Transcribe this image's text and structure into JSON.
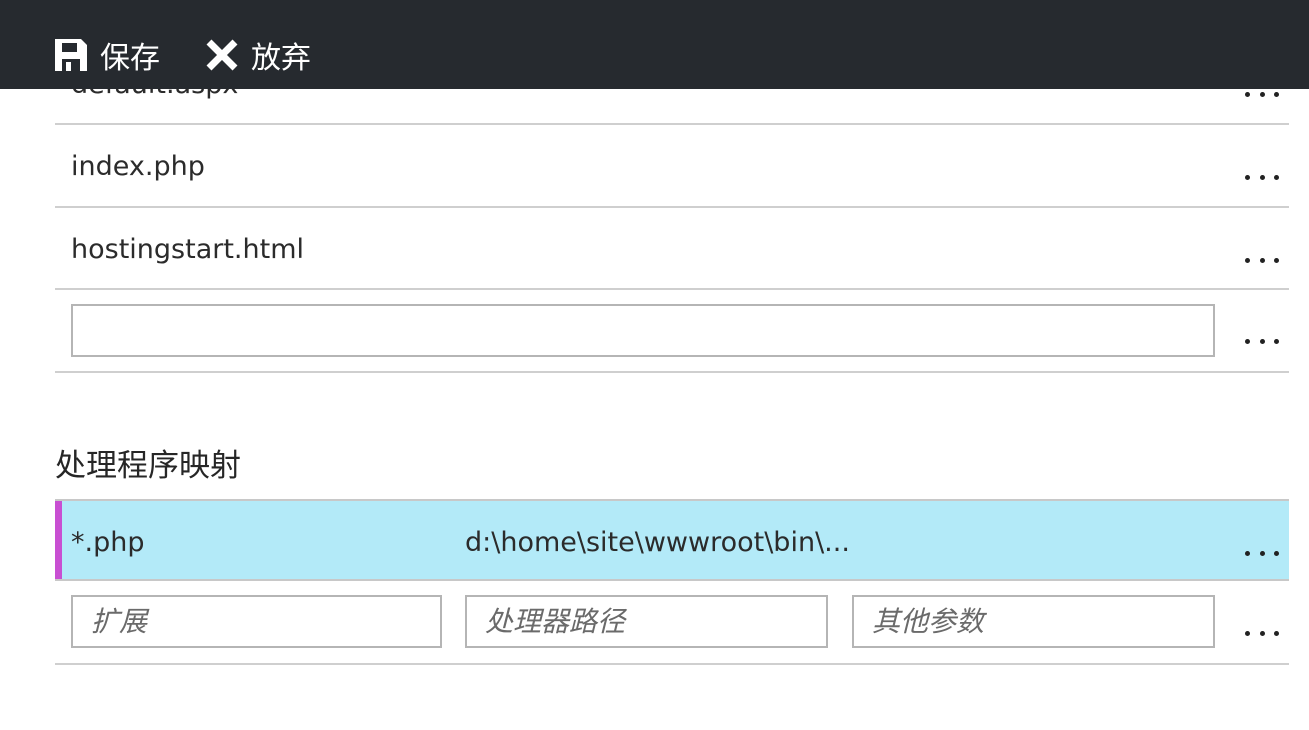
{
  "toolbar": {
    "save_label": "保存",
    "save_icon": "save-icon",
    "discard_label": "放弃",
    "discard_icon": "close-icon"
  },
  "default_documents": {
    "items": [
      {
        "name": "default.aspx"
      },
      {
        "name": "index.php"
      },
      {
        "name": "hostingstart.html"
      }
    ],
    "new_item_value": ""
  },
  "handler_mappings": {
    "title": "处理程序映射",
    "rows": [
      {
        "extension": "*.php",
        "processor_path": "d:\\home\\site\\wwwroot\\bin\\..."
      }
    ],
    "new_row": {
      "extension_placeholder": "扩展",
      "processor_placeholder": "处理器路径",
      "args_placeholder": "其他参数"
    }
  },
  "colors": {
    "toolbar_bg": "#262a2f",
    "selected_row_bg": "#b3eaf8",
    "selected_accent": "#c84fd2"
  }
}
